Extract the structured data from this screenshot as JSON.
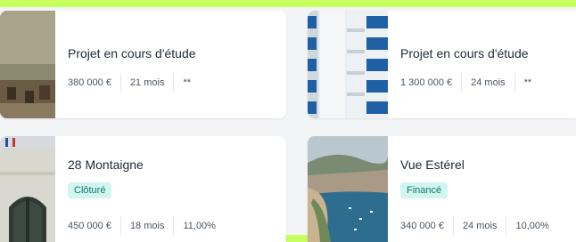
{
  "cards": [
    {
      "title": "Projet en cours d'étude",
      "amount": "380 000 €",
      "duration": "21 mois",
      "rate": "**"
    },
    {
      "title": "Projet en cours d'étude",
      "amount": "1 300 000 €",
      "duration": "24 mois",
      "rate": "**"
    },
    {
      "title": "28 Montaigne",
      "status": "Clôturé",
      "amount": "450 000 €",
      "duration": "18 mois",
      "rate": "11,00%"
    },
    {
      "title": "Vue Estérel",
      "status": "Financé",
      "amount": "340 000 €",
      "duration": "24 mois",
      "rate": "10,00%"
    }
  ],
  "colors": {
    "frame": "#c6ff5e",
    "background": "#f3f4f6",
    "badge_bg": "#d1f5ef",
    "badge_text": "#0f766e"
  }
}
